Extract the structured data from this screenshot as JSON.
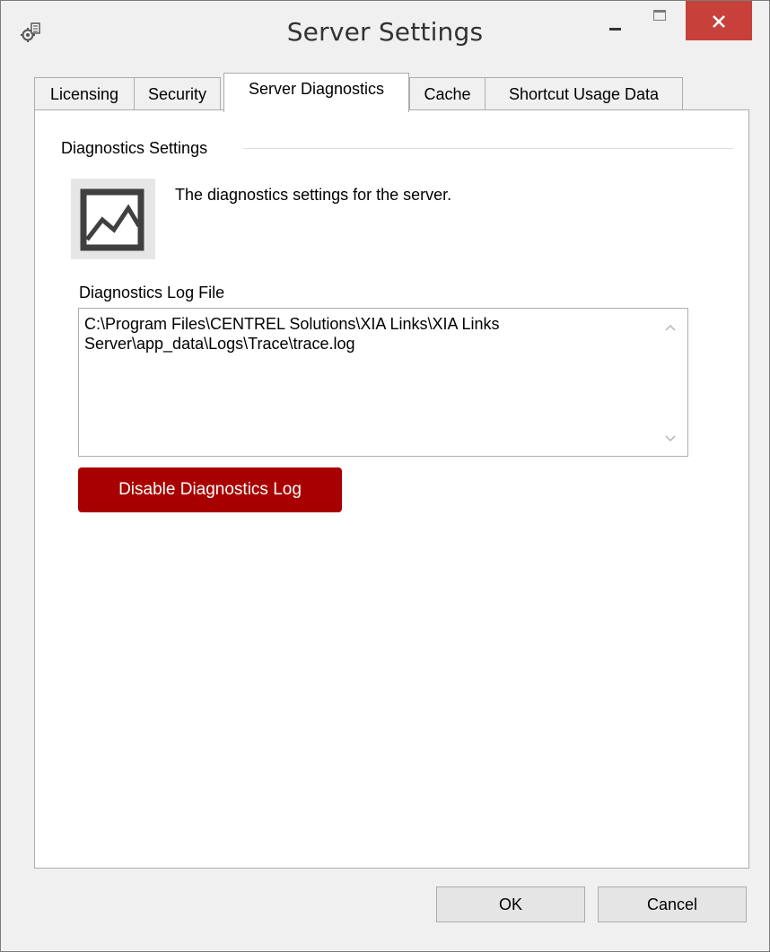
{
  "window": {
    "title": "Server Settings",
    "icon": "settings-gear-server-icon"
  },
  "titlebar_buttons": {
    "minimize_icon": "minimize-icon",
    "maximize_icon": "maximize-icon",
    "close_icon": "close-icon",
    "close_color": "#c7413a"
  },
  "tabs": [
    {
      "label": "Licensing",
      "active": false
    },
    {
      "label": "Security",
      "active": false
    },
    {
      "label": "Server Diagnostics",
      "active": true
    },
    {
      "label": "Cache",
      "active": false
    },
    {
      "label": "Shortcut Usage Data",
      "active": false
    }
  ],
  "diagnostics": {
    "group_label": "Diagnostics Settings",
    "icon": "line-chart-icon",
    "description": "The diagnostics settings for the server.",
    "log_file_label": "Diagnostics Log File",
    "log_file_path": "C:\\Program Files\\CENTREL Solutions\\XIA Links\\XIA Links Server\\app_data\\Logs\\Trace\\trace.log",
    "disable_button_label": "Disable Diagnostics Log",
    "disable_button_color": "#a80000"
  },
  "footer": {
    "ok_label": "OK",
    "cancel_label": "Cancel"
  }
}
